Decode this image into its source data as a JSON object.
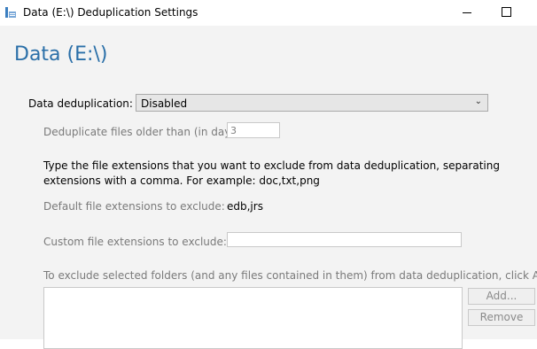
{
  "window": {
    "title": "Data (E:\\) Deduplication Settings",
    "icon": "server-manager-icon"
  },
  "heading": "Data (E:\\)",
  "dedup": {
    "label": "Data deduplication:",
    "selected": "Disabled"
  },
  "age": {
    "label": "Deduplicate files older than (in days):",
    "value": "3"
  },
  "instructions": "Type the file extensions that you want to exclude from data deduplication, separating extensions with a comma. For example: doc,txt,png",
  "default_ext": {
    "label": "Default file extensions to exclude:",
    "value": "edb,jrs"
  },
  "custom_ext": {
    "label": "Custom file extensions to exclude:",
    "value": ""
  },
  "folders": {
    "instruction": "To exclude selected folders (and any files contained in them) from data deduplication, click Add.",
    "add_label": "Add...",
    "remove_label": "Remove"
  },
  "colors": {
    "heading": "#2a6fa8",
    "disabled_text": "#7a7a7a",
    "content_bg": "#f3f3f3"
  }
}
